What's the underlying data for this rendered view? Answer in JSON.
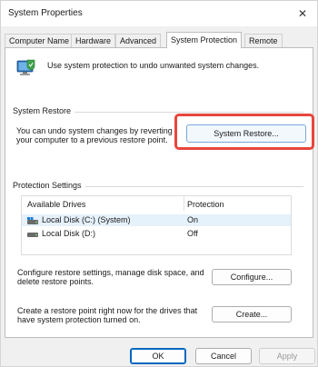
{
  "window": {
    "title": "System Properties",
    "close_glyph": "✕"
  },
  "tabs": [
    {
      "label": "Computer Name",
      "active": false
    },
    {
      "label": "Hardware",
      "active": false
    },
    {
      "label": "Advanced",
      "active": false
    },
    {
      "label": "System Protection",
      "active": true
    },
    {
      "label": "Remote",
      "active": false
    }
  ],
  "intro": {
    "icon": "system-protection-icon",
    "text": "Use system protection to undo unwanted system changes."
  },
  "system_restore": {
    "group_label": "System Restore",
    "description": "You can undo system changes by reverting your computer to a previous restore point.",
    "button_label": "System Restore..."
  },
  "protection_settings": {
    "group_label": "Protection Settings",
    "columns": [
      "Available Drives",
      "Protection"
    ],
    "drives": [
      {
        "name": "Local Disk (C:) (System)",
        "protection": "On",
        "icon": "system-drive-icon",
        "selected": true
      },
      {
        "name": "Local Disk (D:)",
        "protection": "Off",
        "icon": "drive-icon",
        "selected": false
      }
    ],
    "configure_text": "Configure restore settings, manage disk space, and delete restore points.",
    "configure_label": "Configure...",
    "create_text": "Create a restore point right now for the drives that have system protection turned on.",
    "create_label": "Create..."
  },
  "footer": {
    "ok_label": "OK",
    "cancel_label": "Cancel",
    "apply_label": "Apply"
  },
  "colors": {
    "highlight": "#e8453c",
    "accent": "#0067c0",
    "selected_row": "#e5f1fb"
  }
}
